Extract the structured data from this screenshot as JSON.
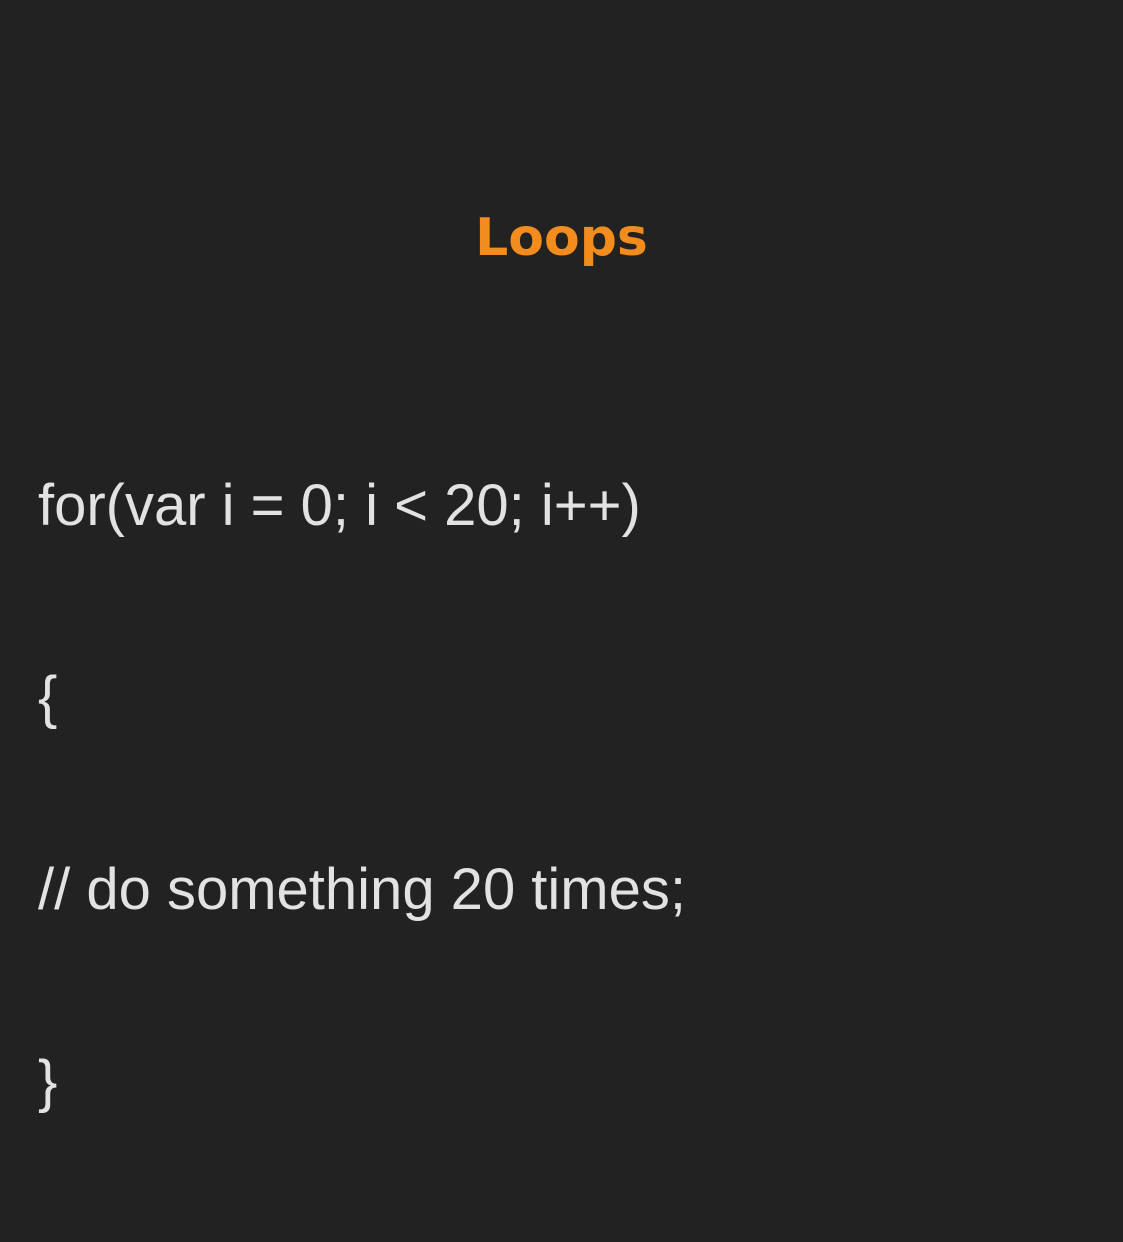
{
  "slide": {
    "title": "Loops",
    "code_lines": [
      "for(var i = 0; i < 20; i++)",
      "{",
      "// do something 20 times;",
      "}"
    ]
  },
  "colors": {
    "background": "#222222",
    "title": "#f28c1c",
    "code_text": "#e2e2e2"
  }
}
